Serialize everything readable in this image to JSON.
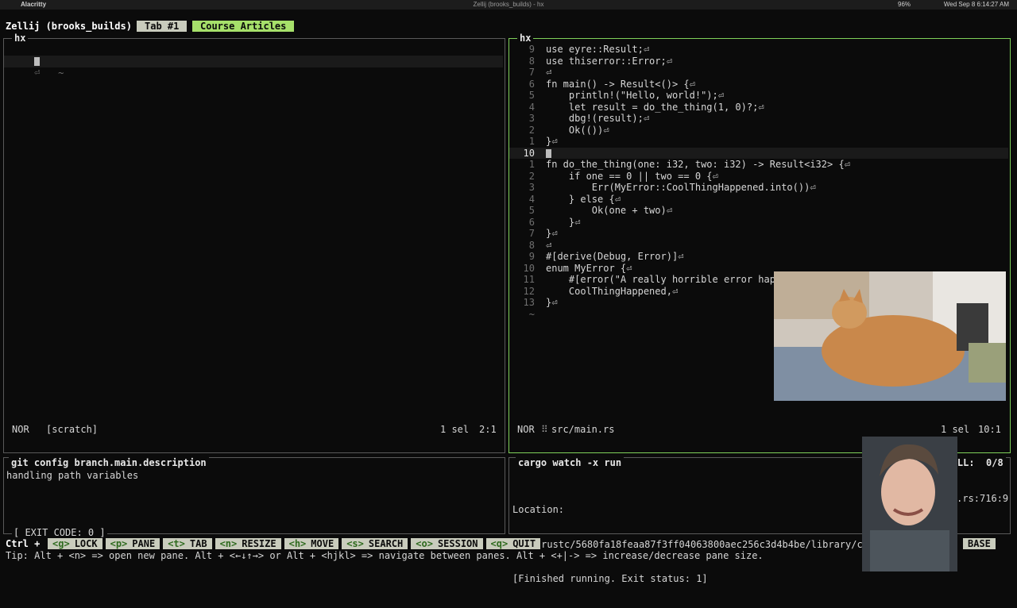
{
  "menubar": {
    "app": "Alacritty",
    "window_title": "Zellij (brooks_builds) - hx",
    "battery": "96%",
    "clock": "Wed Sep 8  6:14:27 AM"
  },
  "zellij": {
    "session": "Zellij (brooks_builds)",
    "tabs": [
      {
        "label": "Tab #1",
        "active": false
      },
      {
        "label": "Course Articles",
        "active": true
      }
    ]
  },
  "left_editor": {
    "title": "hx",
    "lines": [
      {
        "num": "1",
        "text": "⏎"
      },
      {
        "num": "~",
        "text": ""
      }
    ],
    "status": {
      "mode": "NOR",
      "file": "[scratch]",
      "sel": "1 sel",
      "pos": "2:1"
    }
  },
  "right_editor": {
    "title": "hx",
    "lines": [
      {
        "num": "9",
        "text": "use eyre::Result;⏎"
      },
      {
        "num": "8",
        "text": "use thiserror::Error;⏎"
      },
      {
        "num": "7",
        "text": "⏎"
      },
      {
        "num": "6",
        "text": "fn main() -> Result<()> {⏎"
      },
      {
        "num": "5",
        "text": "    println!(\"Hello, world!\");⏎"
      },
      {
        "num": "4",
        "text": "    let result = do_the_thing(1, 0)?;⏎"
      },
      {
        "num": "3",
        "text": "    dbg!(result);⏎"
      },
      {
        "num": "2",
        "text": "    Ok(())⏎"
      },
      {
        "num": "1",
        "text": "}⏎"
      },
      {
        "num": "10",
        "text": ""
      },
      {
        "num": "1",
        "text": "fn do_the_thing(one: i32, two: i32) -> Result<i32> {⏎"
      },
      {
        "num": "2",
        "text": "    if one == 0 || two == 0 {⏎"
      },
      {
        "num": "3",
        "text": "        Err(MyError::CoolThingHappened.into())⏎"
      },
      {
        "num": "4",
        "text": "    } else {⏎"
      },
      {
        "num": "5",
        "text": "        Ok(one + two)⏎"
      },
      {
        "num": "6",
        "text": "    }⏎"
      },
      {
        "num": "7",
        "text": "}⏎"
      },
      {
        "num": "8",
        "text": "⏎"
      },
      {
        "num": "9",
        "text": "#[derive(Debug, Error)]⏎"
      },
      {
        "num": "10",
        "text": "enum MyError {⏎"
      },
      {
        "num": "11",
        "text": "    #[error(\"A really horrible error happ"
      },
      {
        "num": "12",
        "text": "    CoolThingHappened,⏎"
      },
      {
        "num": "13",
        "text": "}⏎"
      },
      {
        "num": "~",
        "text": ""
      }
    ],
    "status": {
      "mode": "NOR",
      "file": "src/main.rs",
      "sel": "1 sel",
      "pos": "10:1"
    }
  },
  "git_pane": {
    "title": "git config branch.main.description",
    "body": "handling path variables",
    "exit": "[ EXIT CODE: 0 ]"
  },
  "cargo_pane": {
    "title": "cargo watch -x run",
    "scroll": "SCROLL:  0/8",
    "lines": [
      "Location:",
      "    /rustc/5680fa18feaa87f3ff04063800aec256c3d4b4be/library/cor",
      "[Finished running. Exit status: 1]"
    ],
    "tail": "t/mod.rs:716:9"
  },
  "keybar": {
    "ctrl": "Ctrl +",
    "keys": [
      {
        "key": "<g>",
        "label": "LOCK"
      },
      {
        "key": "<p>",
        "label": "PANE"
      },
      {
        "key": "<t>",
        "label": "TAB"
      },
      {
        "key": "<n>",
        "label": "RESIZE"
      },
      {
        "key": "<h>",
        "label": "MOVE"
      },
      {
        "key": "<s>",
        "label": "SEARCH"
      },
      {
        "key": "<o>",
        "label": "SESSION"
      },
      {
        "key": "<q>",
        "label": "QUIT"
      }
    ],
    "base": "BASE"
  },
  "tip": "Tip: Alt + <n> => open new pane. Alt + <←↓↑→> or Alt + <hjkl> => navigate between panes. Alt + <+|-> => increase/decrease pane size."
}
